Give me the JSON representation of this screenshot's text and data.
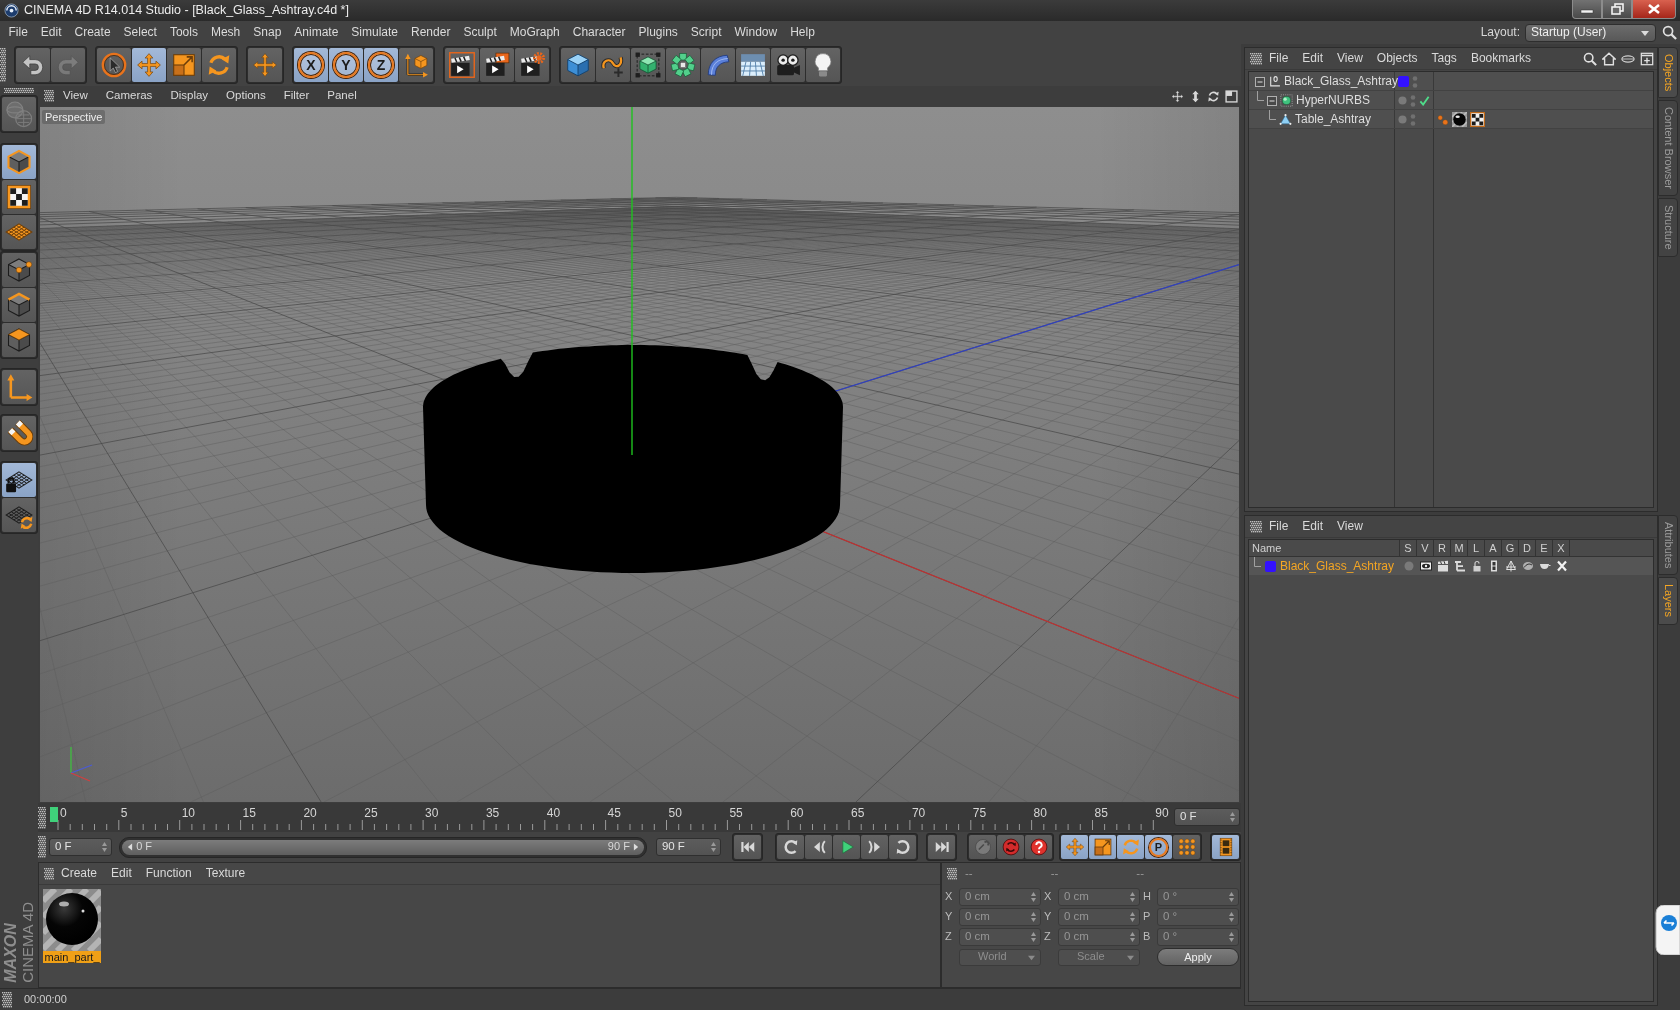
{
  "window": {
    "title": "CINEMA 4D R14.014 Studio - [Black_Glass_Ashtray.c4d *]"
  },
  "menu_bar": [
    "File",
    "Edit",
    "Create",
    "Select",
    "Tools",
    "Mesh",
    "Snap",
    "Animate",
    "Simulate",
    "Render",
    "Sculpt",
    "MoGraph",
    "Character",
    "Plugins",
    "Script",
    "Window",
    "Help"
  ],
  "layout": {
    "label": "Layout:",
    "value": "Startup (User)"
  },
  "toolbar": [
    [
      {
        "kind": "undo",
        "selected": false,
        "disabled": false
      },
      {
        "kind": "redo",
        "selected": false,
        "disabled": true
      }
    ],
    [
      {
        "kind": "select",
        "selected": false,
        "disabled": false
      },
      {
        "kind": "move",
        "selected": true,
        "disabled": false
      },
      {
        "kind": "scale",
        "selected": false,
        "disabled": false
      },
      {
        "kind": "rotate",
        "selected": false,
        "disabled": false
      }
    ],
    [
      {
        "kind": "plus",
        "selected": false,
        "disabled": false
      }
    ],
    [
      {
        "kind": "axis_lock",
        "label": "X",
        "selected": true,
        "disabled": false
      },
      {
        "kind": "axis_lock",
        "label": "Y",
        "selected": true,
        "disabled": false
      },
      {
        "kind": "axis_lock",
        "label": "Z",
        "selected": true,
        "disabled": false
      },
      {
        "kind": "coord_system",
        "selected": false,
        "disabled": false
      }
    ],
    [
      {
        "kind": "render_view",
        "selected": false,
        "disabled": false
      },
      {
        "kind": "render_picture",
        "selected": false,
        "disabled": false
      },
      {
        "kind": "render_settings",
        "selected": false,
        "disabled": false
      }
    ],
    [
      {
        "kind": "cube",
        "selected": false,
        "disabled": false
      },
      {
        "kind": "spline",
        "selected": false,
        "disabled": false
      },
      {
        "kind": "subdivision",
        "selected": false,
        "disabled": false
      },
      {
        "kind": "cloner",
        "selected": false,
        "disabled": false
      },
      {
        "kind": "deformer",
        "selected": false,
        "disabled": false
      },
      {
        "kind": "floor",
        "selected": false,
        "disabled": false
      },
      {
        "kind": "camera",
        "selected": false,
        "disabled": false
      },
      {
        "kind": "light",
        "selected": false,
        "disabled": false
      }
    ]
  ],
  "mode_toolbar": [
    [
      {
        "kind": "convert",
        "selected": false,
        "disabled": true
      }
    ],
    [
      {
        "kind": "model",
        "selected": true,
        "disabled": false
      },
      {
        "kind": "texture",
        "selected": false,
        "disabled": false
      },
      {
        "kind": "workplane",
        "selected": false,
        "disabled": false
      }
    ],
    [
      {
        "kind": "points",
        "selected": false,
        "disabled": false
      },
      {
        "kind": "edges",
        "selected": false,
        "disabled": false
      },
      {
        "kind": "polygons",
        "selected": false,
        "disabled": false
      }
    ],
    [
      {
        "kind": "axis",
        "selected": false,
        "disabled": false
      }
    ],
    [
      {
        "kind": "magnet",
        "selected": false,
        "disabled": false
      }
    ],
    [
      {
        "kind": "grid_lock",
        "selected": true,
        "disabled": false
      },
      {
        "kind": "grid_rotate",
        "selected": false,
        "disabled": false
      }
    ]
  ],
  "viewport": {
    "menu": [
      "View",
      "Cameras",
      "Display",
      "Options",
      "Filter",
      "Panel"
    ],
    "camera": "Perspective"
  },
  "timeline": {
    "frame_labels": [
      "0",
      "5",
      "10",
      "15",
      "20",
      "25",
      "30",
      "35",
      "40",
      "45",
      "50",
      "55",
      "60",
      "65",
      "70",
      "75",
      "80",
      "85",
      "90"
    ],
    "current_frame": "0 F",
    "start_frame": "0 F",
    "range": {
      "start": "0 F",
      "end": "90 F",
      "level": 1
    },
    "end_frame": "90 F",
    "key_buttons": [
      {
        "kind": "move",
        "selected": true
      },
      {
        "kind": "scale",
        "selected": true
      },
      {
        "kind": "rotate",
        "selected": true
      },
      {
        "kind": "param",
        "label": "P",
        "selected": true
      },
      {
        "kind": "point_level",
        "selected": false
      }
    ],
    "timeline_button": {
      "selected": true
    }
  },
  "material_manager": {
    "menu": [
      "Create",
      "Edit",
      "Function",
      "Texture"
    ],
    "materials": [
      {
        "name": "main_part_",
        "selected": true
      }
    ]
  },
  "coordinates": {
    "headers": [
      "--",
      "--",
      "--"
    ],
    "disabled": true,
    "rows": [
      {
        "cells": [
          {
            "axis": "X",
            "value": "0 cm"
          },
          {
            "axis": "X",
            "value": "0 cm"
          },
          {
            "axis": "H",
            "value": "0 °"
          }
        ]
      },
      {
        "cells": [
          {
            "axis": "Y",
            "value": "0 cm"
          },
          {
            "axis": "Y",
            "value": "0 cm"
          },
          {
            "axis": "P",
            "value": "0 °"
          }
        ]
      },
      {
        "cells": [
          {
            "axis": "Z",
            "value": "0 cm"
          },
          {
            "axis": "Z",
            "value": "0 cm"
          },
          {
            "axis": "B",
            "value": "0 °"
          }
        ]
      }
    ],
    "dropdowns": [
      "World",
      "Scale"
    ],
    "apply": "Apply"
  },
  "status_bar": {
    "time": "00:00:00"
  },
  "logo": {
    "brand": "MAXON",
    "product": "CINEMA 4D"
  },
  "object_manager": {
    "menu": [
      "File",
      "Edit",
      "View",
      "Objects",
      "Tags",
      "Bookmarks"
    ],
    "objects": [
      {
        "kind": "null",
        "name": "Black_Glass_Ashtray",
        "color": "#3311ff",
        "expanded": true,
        "checked": false,
        "children": [
          {
            "kind": "subdivision",
            "name": "HyperNURBS",
            "expanded": true,
            "checked": true,
            "children": [
              {
                "kind": "polygon",
                "name": "Table_Ashtray",
                "checked": false,
                "tags": [
                  {
                    "kind": "phong"
                  },
                  {
                    "kind": "material"
                  },
                  {
                    "kind": "uvw"
                  }
                ]
              }
            ]
          }
        ]
      }
    ]
  },
  "layer_manager": {
    "menu": [
      "File",
      "Edit",
      "View"
    ],
    "columns": [
      "Name",
      "S",
      "V",
      "R",
      "M",
      "L",
      "A",
      "G",
      "D",
      "E",
      "X"
    ],
    "layers": [
      {
        "name": "Black_Glass_Ashtray",
        "color": "#3311ff",
        "selected": true
      }
    ]
  },
  "side_tabs": [
    {
      "label": "Objects",
      "selected": true
    },
    {
      "label": "Content Browser",
      "selected": false
    },
    {
      "label": "Structure",
      "selected": false
    }
  ],
  "side_tabs_lower": [
    {
      "label": "Attributes",
      "selected": false
    },
    {
      "label": "Layers",
      "selected": true
    }
  ]
}
